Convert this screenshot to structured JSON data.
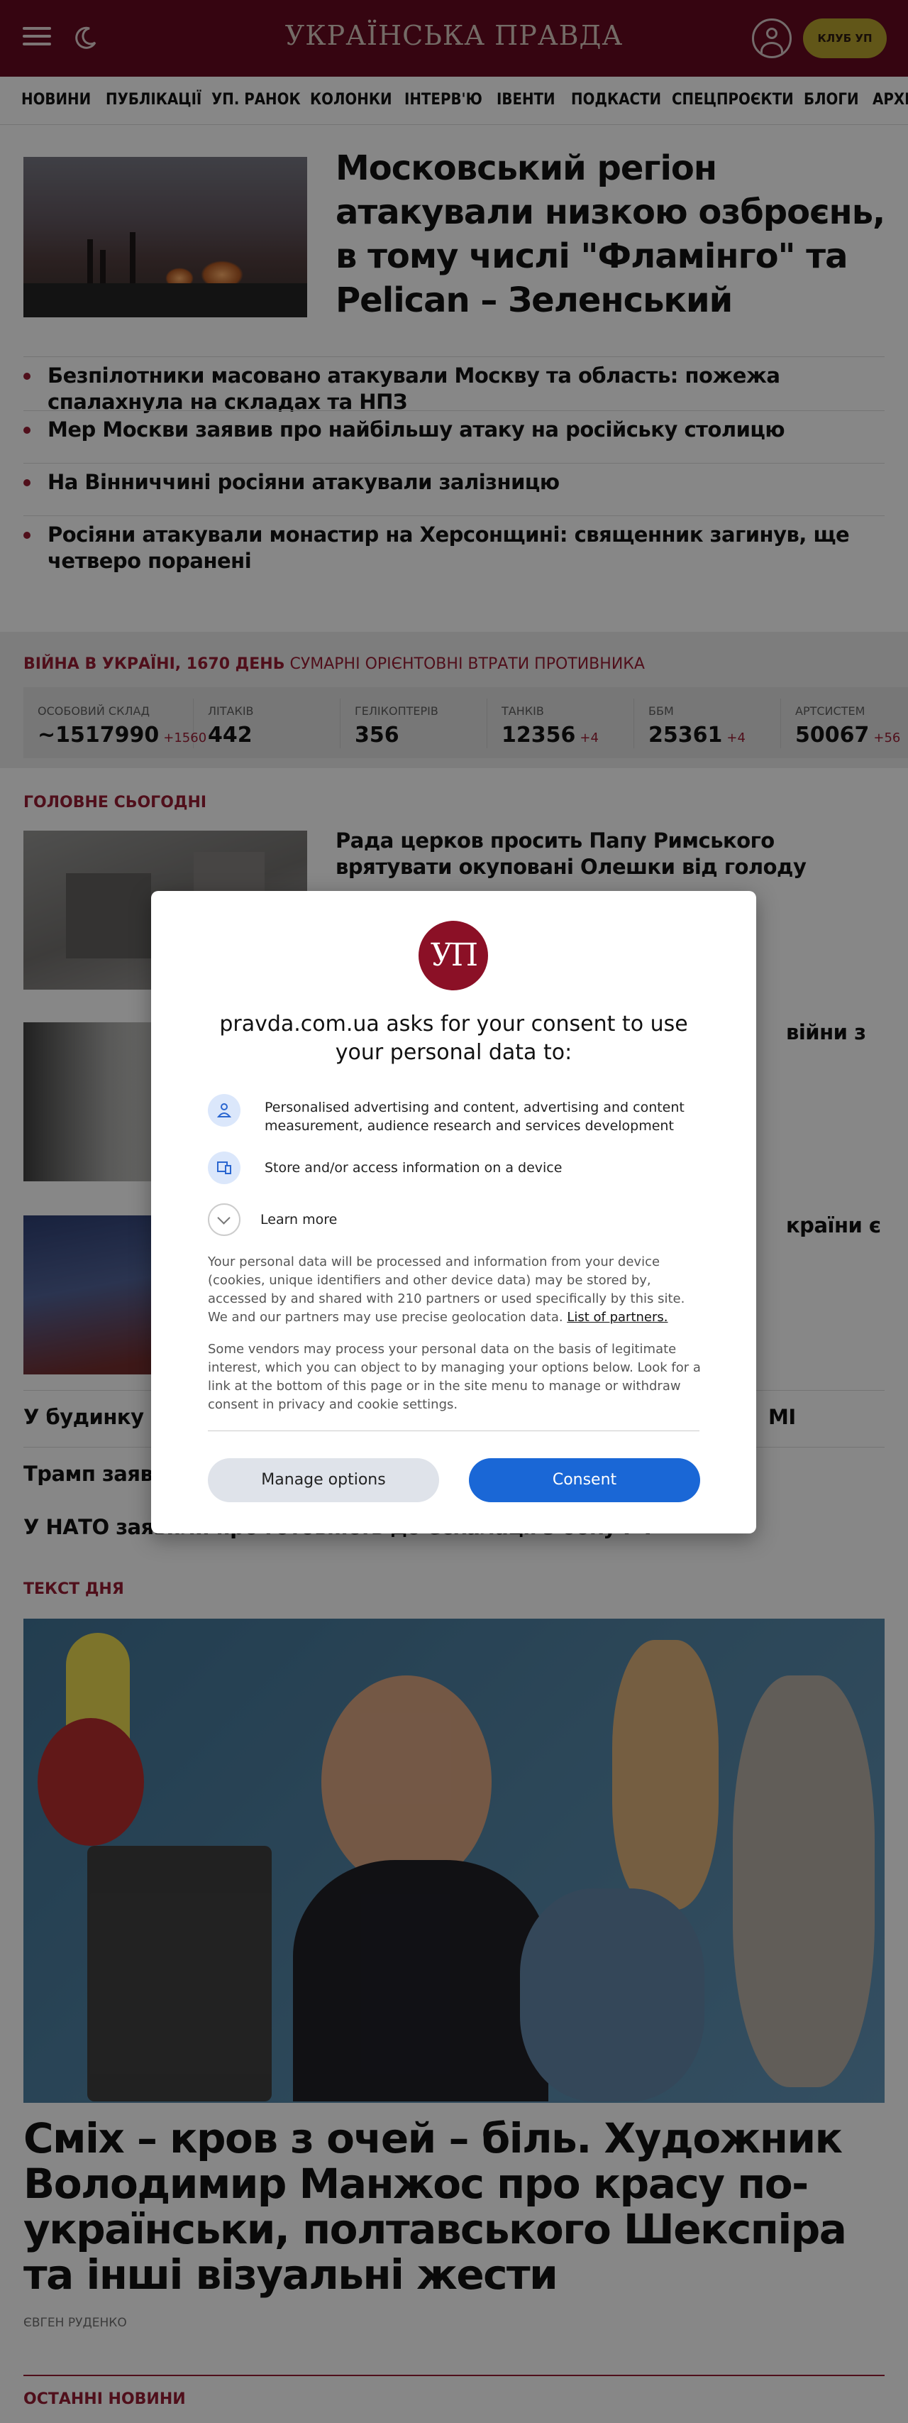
{
  "header": {
    "logo": "УКРАЇНСЬКА ПРАВДА",
    "club_label": "КЛУБ УП"
  },
  "nav": [
    "НОВИНИ",
    "ПУБЛІКАЦІЇ",
    "УП. РАНОК",
    "КОЛОНКИ",
    "ІНТЕРВ'Ю",
    "ІВЕНТИ",
    "ПОДКАСТИ",
    "СПЕЦПРОЄКТИ",
    "БЛОГИ",
    "АРХІВ"
  ],
  "hero": {
    "title": "Московський регіон атакували низкою озброєнь, в тому числі \"Фламінго\" та Pelican – Зеленський"
  },
  "sub_news": [
    "Безпілотники масовано атакували Москву та область: пожежа спалахнула на складах та НПЗ",
    "Мер Москви заявив про найбільшу атаку на російську столицю",
    "На Вінниччині росіяни атакували залізницю",
    "Росіяни атакували монастир на Херсонщині: священник загинув, ще четверо поранені"
  ],
  "war": {
    "label": "ВІЙНА В УКРАЇНІ, 1670 ДЕНЬ",
    "sub": "СУМАРНІ ОРІЄНТОВНІ ВТРАТИ ПРОТИВНИКА",
    "stats": [
      {
        "label": "ОСОБОВИЙ СКЛАД",
        "value": "~1517990",
        "delta": "+1560"
      },
      {
        "label": "ЛІТАКІВ",
        "value": "442",
        "delta": ""
      },
      {
        "label": "ГЕЛІКОПТЕРІВ",
        "value": "356",
        "delta": ""
      },
      {
        "label": "ТАНКІВ",
        "value": "12356",
        "delta": "+4"
      },
      {
        "label": "ББМ",
        "value": "25361",
        "delta": "+4"
      },
      {
        "label": "АРТСИСТЕМ",
        "value": "50067",
        "delta": "+56"
      }
    ]
  },
  "main_today": {
    "title": "ГОЛОВНЕ СЬОГОДНІ",
    "rows": [
      "Рада церков просить Папу Римського врятувати окуповані Олешки від голоду",
      "війни з",
      "країни є"
    ],
    "plain": [
      "У будинку ро",
      "Трамп заявив",
      "У НАТО заявили про готовність до ескалації з боку РФ"
    ],
    "plain_tail": "МІ"
  },
  "text_of_day": {
    "section": "ТЕКСТ ДНЯ",
    "title": "Сміх – кров з очей – біль. Художник Володимир Манжос про красу по-українськи, полтавського Шекспіра та інші візуальні жести",
    "author": "ЄВГЕН РУДЕНКО"
  },
  "latest": {
    "section": "ОСТАННІ НОВИНИ"
  },
  "consent": {
    "logo": "УП",
    "title": "pravda.com.ua asks for your consent to use your personal data to:",
    "purposes": [
      "Personalised advertising and content, advertising and content measurement, audience research and services development",
      "Store and/or access information on a device"
    ],
    "learn_more": "Learn more",
    "body1": "Your personal data will be processed and information from your device (cookies, unique identifiers and other device data) may be stored by, accessed by and shared with 210 partners or used specifically by this site. We and our partners may use precise geolocation data.",
    "partners_link": "List of partners.",
    "body2": "Some vendors may process your personal data on the basis of legitimate interest, which you can object to by managing your options below. Look for a link at the bottom of this page or in the site menu to manage or withdraw consent in privacy and cookie settings.",
    "manage_label": "Manage options",
    "consent_label": "Consent"
  },
  "colors": {
    "header_bg": "#5e0a1e",
    "accent": "#8a1a30",
    "club_btn": "#a8942a",
    "consent_btn": "#1a67d6"
  },
  "icons": [
    "menu-icon",
    "moon-icon",
    "user-icon",
    "person-icon",
    "device-icon",
    "chevron-down-icon"
  ]
}
